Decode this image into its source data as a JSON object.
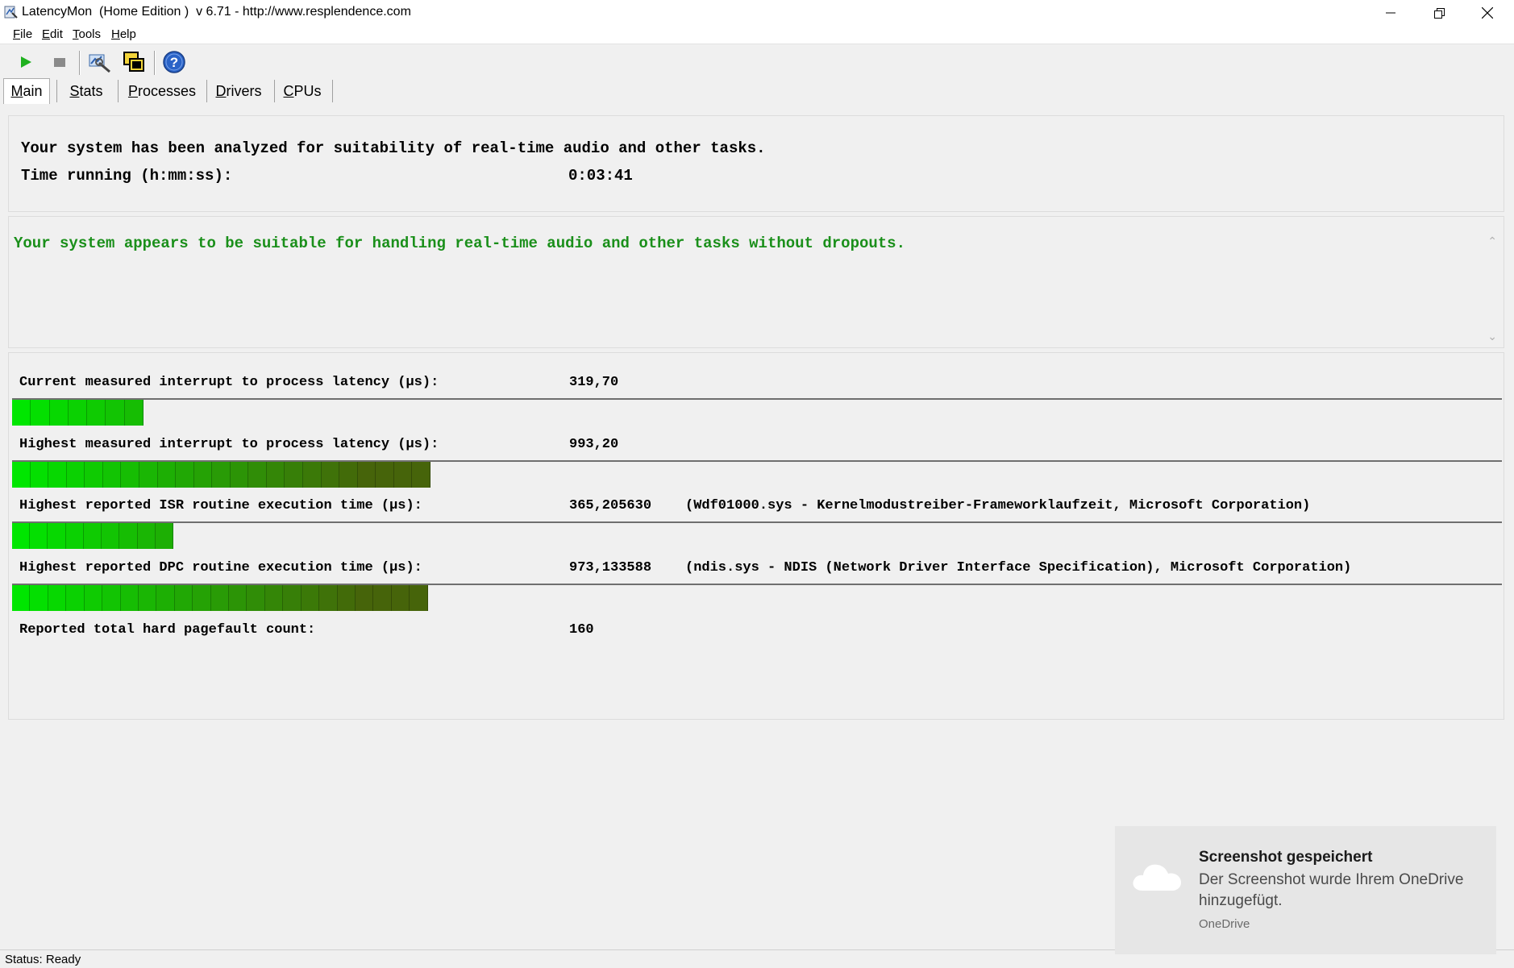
{
  "window": {
    "title": "LatencyMon  (Home Edition )  v 6.71 - http://www.resplendence.com",
    "minimize_icon": "minimize-icon",
    "restore_icon": "restore-icon",
    "close_icon": "close-icon"
  },
  "menu": {
    "items": [
      {
        "u": "F",
        "rest": "ile"
      },
      {
        "u": "E",
        "rest": "dit"
      },
      {
        "u": "T",
        "rest": "ools"
      },
      {
        "u": "H",
        "rest": "elp"
      }
    ]
  },
  "toolbar": {
    "icons": [
      "play-icon",
      "stop-icon",
      "analyze-icon",
      "windows-icon",
      "help-icon"
    ]
  },
  "tabs": [
    {
      "u": "M",
      "rest": "ain"
    },
    {
      "u": "S",
      "rest": "tats"
    },
    {
      "u": "P",
      "rest": "rocesses"
    },
    {
      "u": "D",
      "rest": "rivers"
    },
    {
      "u": "C",
      "rest": "PUs"
    }
  ],
  "summary": {
    "analyzed_text": "Your system has been analyzed for suitability of real-time audio and other tasks.",
    "time_label": "Time running (h:mm:ss):",
    "time_value": "0:03:41"
  },
  "verdict": {
    "text": "Your system appears to be suitable for handling real-time audio and other tasks without dropouts.",
    "color": "#1a8f1a"
  },
  "measurements": [
    {
      "label": "Current measured interrupt to process latency (µs):",
      "value": "319,70",
      "detail": "",
      "level": 0.088
    },
    {
      "label": "Highest measured interrupt to process latency (µs):",
      "value": "993,20",
      "detail": "",
      "level": 0.281
    },
    {
      "label": "Highest reported ISR routine execution time (µs):",
      "value": "365,205630",
      "detail": "(Wdf01000.sys - Kernelmodustreiber-Frameworklaufzeit, Microsoft Corporation)",
      "level": 0.108
    },
    {
      "label": "Highest reported DPC routine execution time (µs):",
      "value": "973,133588",
      "detail": "(ndis.sys - NDIS (Network Driver Interface Specification), Microsoft Corporation)",
      "level": 0.279
    }
  ],
  "pagefault": {
    "label": "Reported total hard pagefault count:",
    "value": "160"
  },
  "status": {
    "text": "Status: Ready"
  },
  "toast": {
    "title": "Screenshot gespeichert",
    "body": "Der Screenshot wurde Ihrem OneDrive hinzugefügt.",
    "source": "OneDrive",
    "icon": "cloud-icon"
  }
}
